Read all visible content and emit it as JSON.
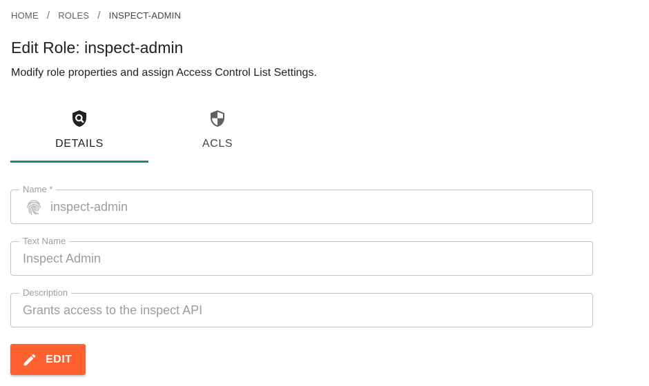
{
  "breadcrumb": {
    "items": [
      "HOME",
      "ROLES",
      "INSPECT-ADMIN"
    ],
    "separator": "/"
  },
  "header": {
    "title": "Edit Role: inspect-admin",
    "subtitle": "Modify role properties and assign Access Control List Settings."
  },
  "tabs": [
    {
      "label": "DETAILS",
      "icon": "shield-search-icon",
      "active": true
    },
    {
      "label": "ACLS",
      "icon": "shield-half-icon",
      "active": false
    }
  ],
  "form": {
    "name": {
      "label": "Name *",
      "value": "inspect-admin",
      "icon": "fingerprint-icon"
    },
    "text_name": {
      "label": "Text Name",
      "value": "Inspect Admin"
    },
    "description": {
      "label": "Description",
      "value": "Grants access to the inspect API"
    }
  },
  "actions": {
    "edit_label": "EDIT",
    "edit_icon": "pencil-icon"
  },
  "colors": {
    "accent": "#1e8a7d",
    "button": "#ff6131"
  }
}
